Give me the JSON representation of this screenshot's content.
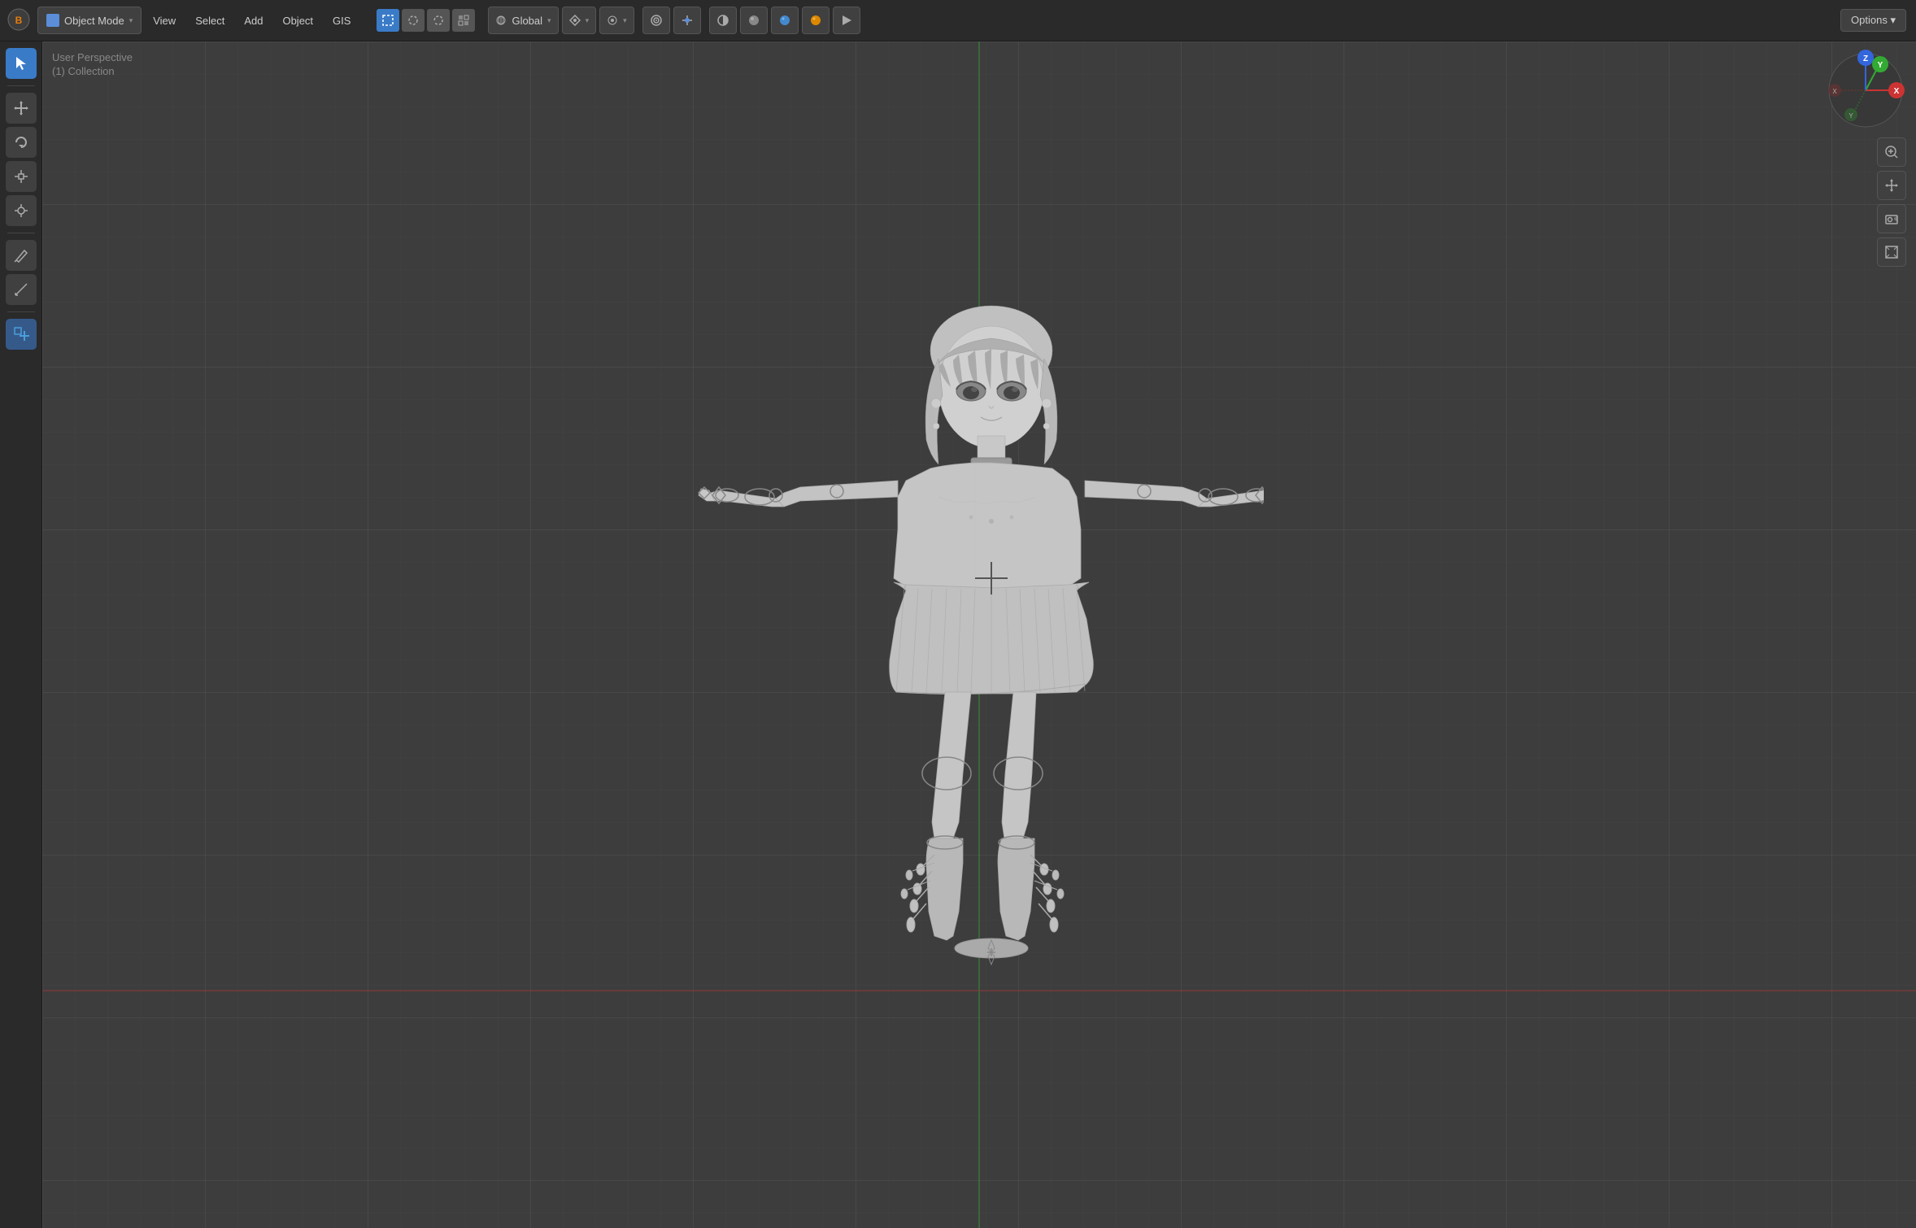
{
  "app": {
    "title": "Blender"
  },
  "topbar": {
    "mode_label": "Object Mode",
    "menu_items": [
      "View",
      "Select",
      "Add",
      "Object",
      "GIS"
    ],
    "transform_label": "Global",
    "options_label": "Options ▾",
    "selection_icons": [
      "box",
      "circle",
      "lasso",
      "checker"
    ]
  },
  "viewport": {
    "info_line1": "User Perspective",
    "info_line2": "(1) Collection"
  },
  "tools": {
    "items": [
      {
        "icon": "↖",
        "label": "select-tool",
        "active": true
      },
      {
        "icon": "✥",
        "label": "move-tool",
        "active": false
      },
      {
        "icon": "↺",
        "label": "rotate-tool",
        "active": false
      },
      {
        "icon": "⊡",
        "label": "scale-tool",
        "active": false
      },
      {
        "icon": "⊕",
        "label": "transform-tool",
        "active": false
      },
      {
        "icon": "✏",
        "label": "annotate-tool",
        "active": false
      },
      {
        "icon": "📐",
        "label": "measure-tool",
        "active": false
      },
      {
        "icon": "⊞",
        "label": "add-tool",
        "active": false
      }
    ]
  },
  "gizmo": {
    "x_color": "#e04444",
    "y_color": "#44bb44",
    "z_color": "#4477ee",
    "x_neg_color": "#883333",
    "y_neg_color": "#336633"
  },
  "right_panel": {
    "buttons": [
      {
        "icon": "🔍",
        "label": "zoom-icon"
      },
      {
        "icon": "✋",
        "label": "pan-icon"
      },
      {
        "icon": "🎥",
        "label": "camera-icon"
      },
      {
        "icon": "⊞",
        "label": "grid-icon"
      }
    ]
  }
}
